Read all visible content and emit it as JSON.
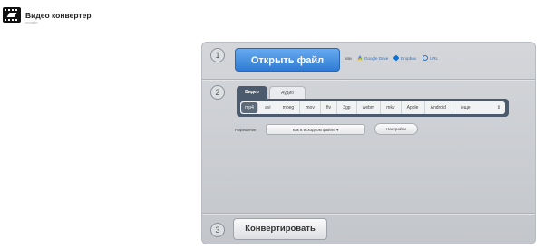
{
  "header": {
    "title": "Видео конвертер",
    "subtitle": "онлайн"
  },
  "steps": {
    "one": "1",
    "two": "2",
    "three": "3"
  },
  "open": {
    "button_label": "Открыть файл",
    "or_text": "или",
    "sources": [
      {
        "label": "Google Drive",
        "icon": "google-drive-icon"
      },
      {
        "label": "Dropbox",
        "icon": "dropbox-icon"
      },
      {
        "label": "URL",
        "icon": "link-icon"
      }
    ]
  },
  "tabs": [
    "Видео",
    "Аудио"
  ],
  "formats": [
    "mp4",
    "avi",
    "mpeg",
    "mov",
    "flv",
    "3gp",
    "webm",
    "mkv",
    "Apple",
    "Android",
    "еще"
  ],
  "resolution": {
    "label": "Разрешение:",
    "value": "Как в исходном файле"
  },
  "settings_label": "Настройки",
  "convert_label": "Конвертировать",
  "colors": {
    "accent": "#2f7bd4",
    "tab_dark": "#4b5a6c",
    "panel": "#c8cbd0"
  }
}
